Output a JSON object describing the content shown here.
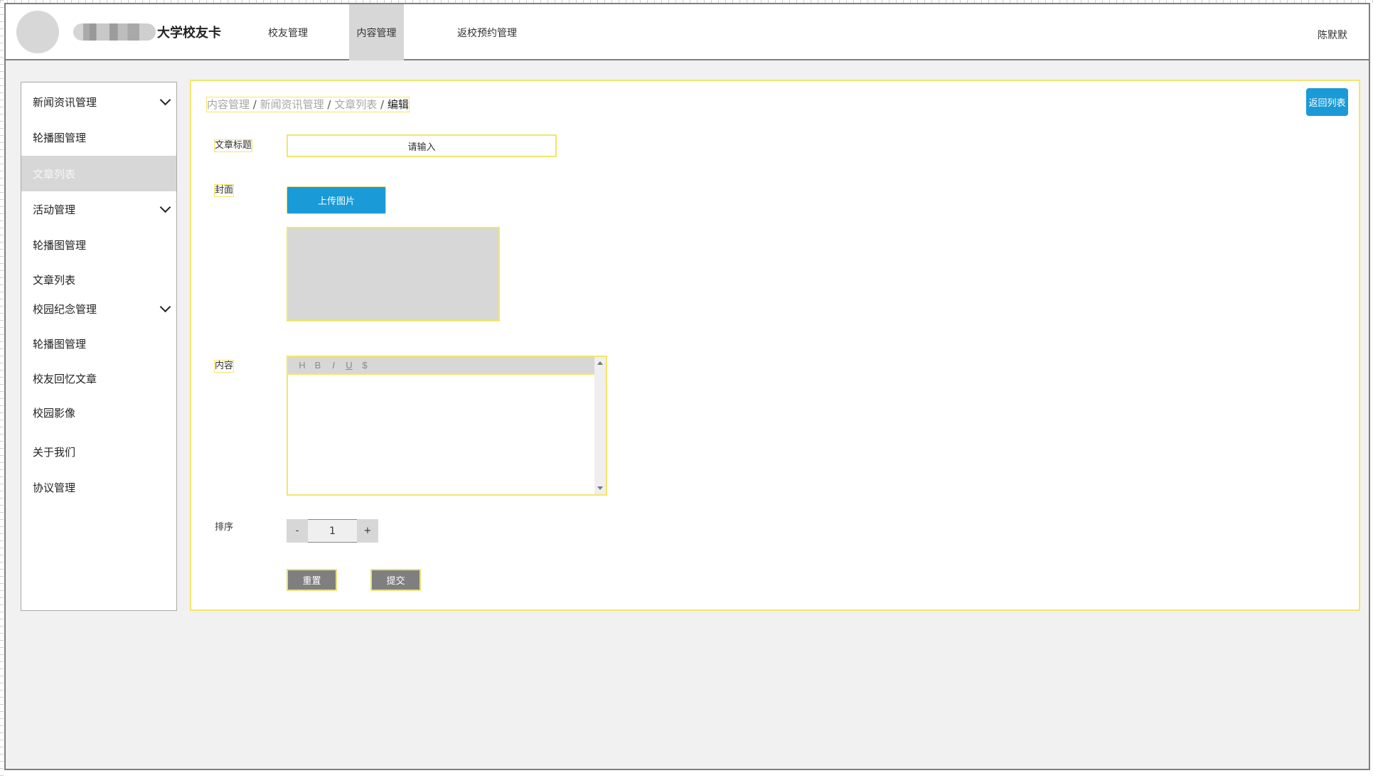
{
  "header": {
    "brand_name": "大学校友卡",
    "nav": [
      {
        "label": "校友管理",
        "active": false
      },
      {
        "label": "内容管理",
        "active": true
      },
      {
        "label": "返校预约管理",
        "active": false
      }
    ],
    "user_name": "陈默默"
  },
  "sidebar": {
    "items": [
      {
        "label": "新闻资讯管理",
        "type": "group",
        "icon": "chevron-down-icon"
      },
      {
        "label": "轮播图管理",
        "type": "item"
      },
      {
        "label": "文章列表",
        "type": "item",
        "active": true
      },
      {
        "label": "活动管理",
        "type": "group",
        "icon": "chevron-down-icon"
      },
      {
        "label": "轮播图管理",
        "type": "item"
      },
      {
        "label": "文章列表",
        "type": "item"
      },
      {
        "label": "校园纪念管理",
        "type": "group",
        "icon": "chevron-down-icon"
      },
      {
        "label": "轮播图管理",
        "type": "item"
      },
      {
        "label": "校友回忆文章",
        "type": "item"
      },
      {
        "label": "校园影像",
        "type": "item"
      },
      {
        "label": "关于我们",
        "type": "item"
      },
      {
        "label": "协议管理",
        "type": "item"
      }
    ]
  },
  "breadcrumb": {
    "items": [
      "内容管理",
      "新闻资讯管理",
      "文章列表"
    ],
    "separator": "/",
    "current": "编辑"
  },
  "form": {
    "return_label": "返回列表",
    "title_label": "文章标题",
    "title_placeholder": "请输入",
    "title_value": "",
    "cover_label": "封面",
    "upload_label": "上传图片",
    "content_label": "内容",
    "toolbar": [
      "H",
      "B",
      "I",
      "U",
      "$"
    ],
    "content_value": "",
    "sort_label": "排序",
    "sort_value": "1",
    "decrement_label": "-",
    "increment_label": "+",
    "reset_label": "重置",
    "submit_label": "提交"
  },
  "colors": {
    "accent": "#1a9ad6",
    "highlight_outline": "#f2e66a",
    "active_bg": "#d7d7d7",
    "page_bg": "#f1f1f1",
    "action_button": "#7f7f7f"
  }
}
